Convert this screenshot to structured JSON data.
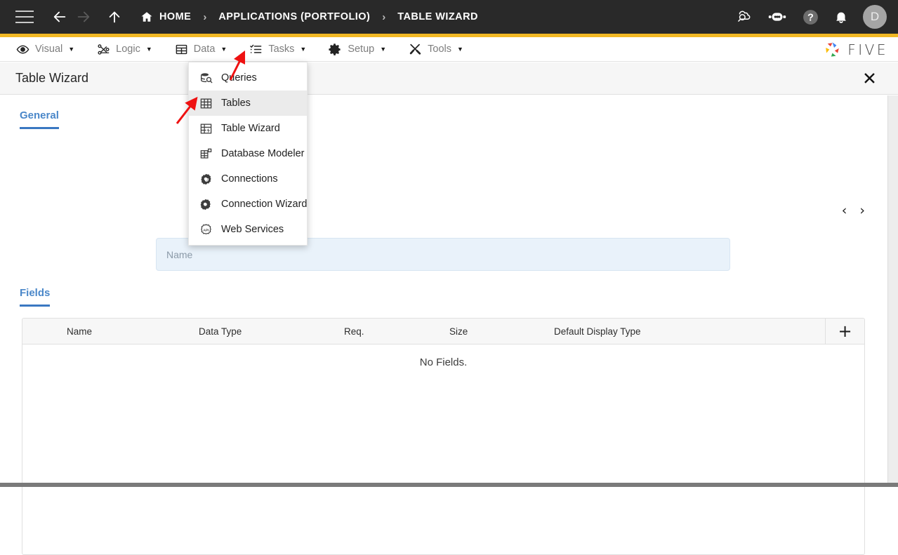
{
  "topbar": {
    "menu_icon": "hamburger-icon",
    "back_icon": "arrow-left-icon",
    "forward_icon": "arrow-right-icon",
    "up_icon": "arrow-up-icon",
    "home_icon": "home-icon",
    "breadcrumbs": [
      {
        "label": "HOME",
        "icon": "home-icon"
      },
      {
        "label": "APPLICATIONS (PORTFOLIO)"
      },
      {
        "label": "TABLE WIZARD"
      }
    ],
    "separator": "›",
    "right_icons": [
      {
        "name": "cloud-search-icon"
      },
      {
        "name": "chatbot-icon"
      },
      {
        "name": "help-icon"
      },
      {
        "name": "notifications-bell-icon"
      }
    ],
    "avatar_initial": "D",
    "accent_color": "#f2b824",
    "background_color": "#292929"
  },
  "menubar": {
    "items": [
      {
        "label": "Visual",
        "icon": "eye-icon",
        "caret": "▼"
      },
      {
        "label": "Logic",
        "icon": "logic-nodes-icon",
        "caret": "▼"
      },
      {
        "label": "Data",
        "icon": "data-grid-icon",
        "caret": "▼"
      },
      {
        "label": "Tasks",
        "icon": "checklist-icon",
        "caret": "▼"
      },
      {
        "label": "Setup",
        "icon": "gear-icon",
        "caret": "▼"
      },
      {
        "label": "Tools",
        "icon": "tools-icon",
        "caret": "▼"
      }
    ],
    "brand": "FIVE"
  },
  "dropdown": {
    "open_for": "Data",
    "items": [
      {
        "label": "Queries",
        "icon": "database-search-icon",
        "highlighted": false
      },
      {
        "label": "Tables",
        "icon": "table-grid-icon",
        "highlighted": true
      },
      {
        "label": "Table Wizard",
        "icon": "table-wizard-icon",
        "highlighted": false
      },
      {
        "label": "Database Modeler",
        "icon": "database-modeler-icon",
        "highlighted": false
      },
      {
        "label": "Connections",
        "icon": "connections-icon",
        "highlighted": false
      },
      {
        "label": "Connection Wizard",
        "icon": "connection-wizard-icon",
        "highlighted": false
      },
      {
        "label": "Web Services",
        "icon": "web-services-api-icon",
        "highlighted": false
      }
    ]
  },
  "page": {
    "title": "Table Wizard",
    "close_label": "✕",
    "tabs": {
      "general": "General",
      "fields": "Fields"
    },
    "pager": {
      "prev": "‹",
      "next": "›"
    },
    "name_input": {
      "placeholder": "Name",
      "value": ""
    },
    "fields_table": {
      "columns": [
        "Name",
        "Data Type",
        "Req.",
        "Size",
        "Default Display Type"
      ],
      "add_button": "+",
      "empty_message": "No Fields.",
      "rows": []
    }
  },
  "annotations": [
    {
      "name": "arrow-pointing-to-data-menu",
      "color": "#ee1111"
    },
    {
      "name": "arrow-pointing-to-tables-item",
      "color": "#ee1111"
    }
  ]
}
